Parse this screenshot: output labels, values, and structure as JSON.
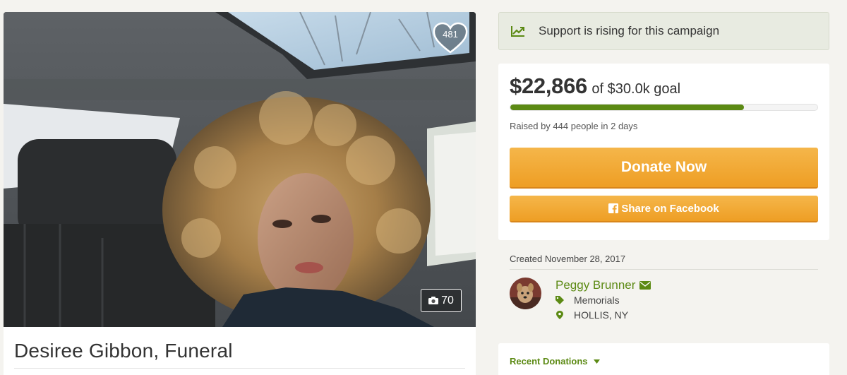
{
  "campaign": {
    "title": "Desiree Gibbon, Funeral",
    "hearts": "481",
    "photo_count": "70"
  },
  "banner": {
    "icon": "trending-up-icon",
    "text": "Support is rising for this campaign"
  },
  "funding": {
    "amount": "$22,866",
    "goal_text": "of $30.0k goal",
    "progress_fraction": 0.762,
    "raised_text": "Raised by 444 people in 2 days",
    "donate_label": "Donate Now",
    "share_label": "Share on Facebook"
  },
  "organizer": {
    "created": "Created November 28, 2017",
    "name": "Peggy Brunner",
    "category": "Memorials",
    "location": "HOLLIS, NY"
  },
  "recent": {
    "label": "Recent Donations"
  },
  "colors": {
    "accent_green": "#5c8a14",
    "button_orange": "#f0a32e",
    "banner_bg": "#e8ebe1"
  }
}
